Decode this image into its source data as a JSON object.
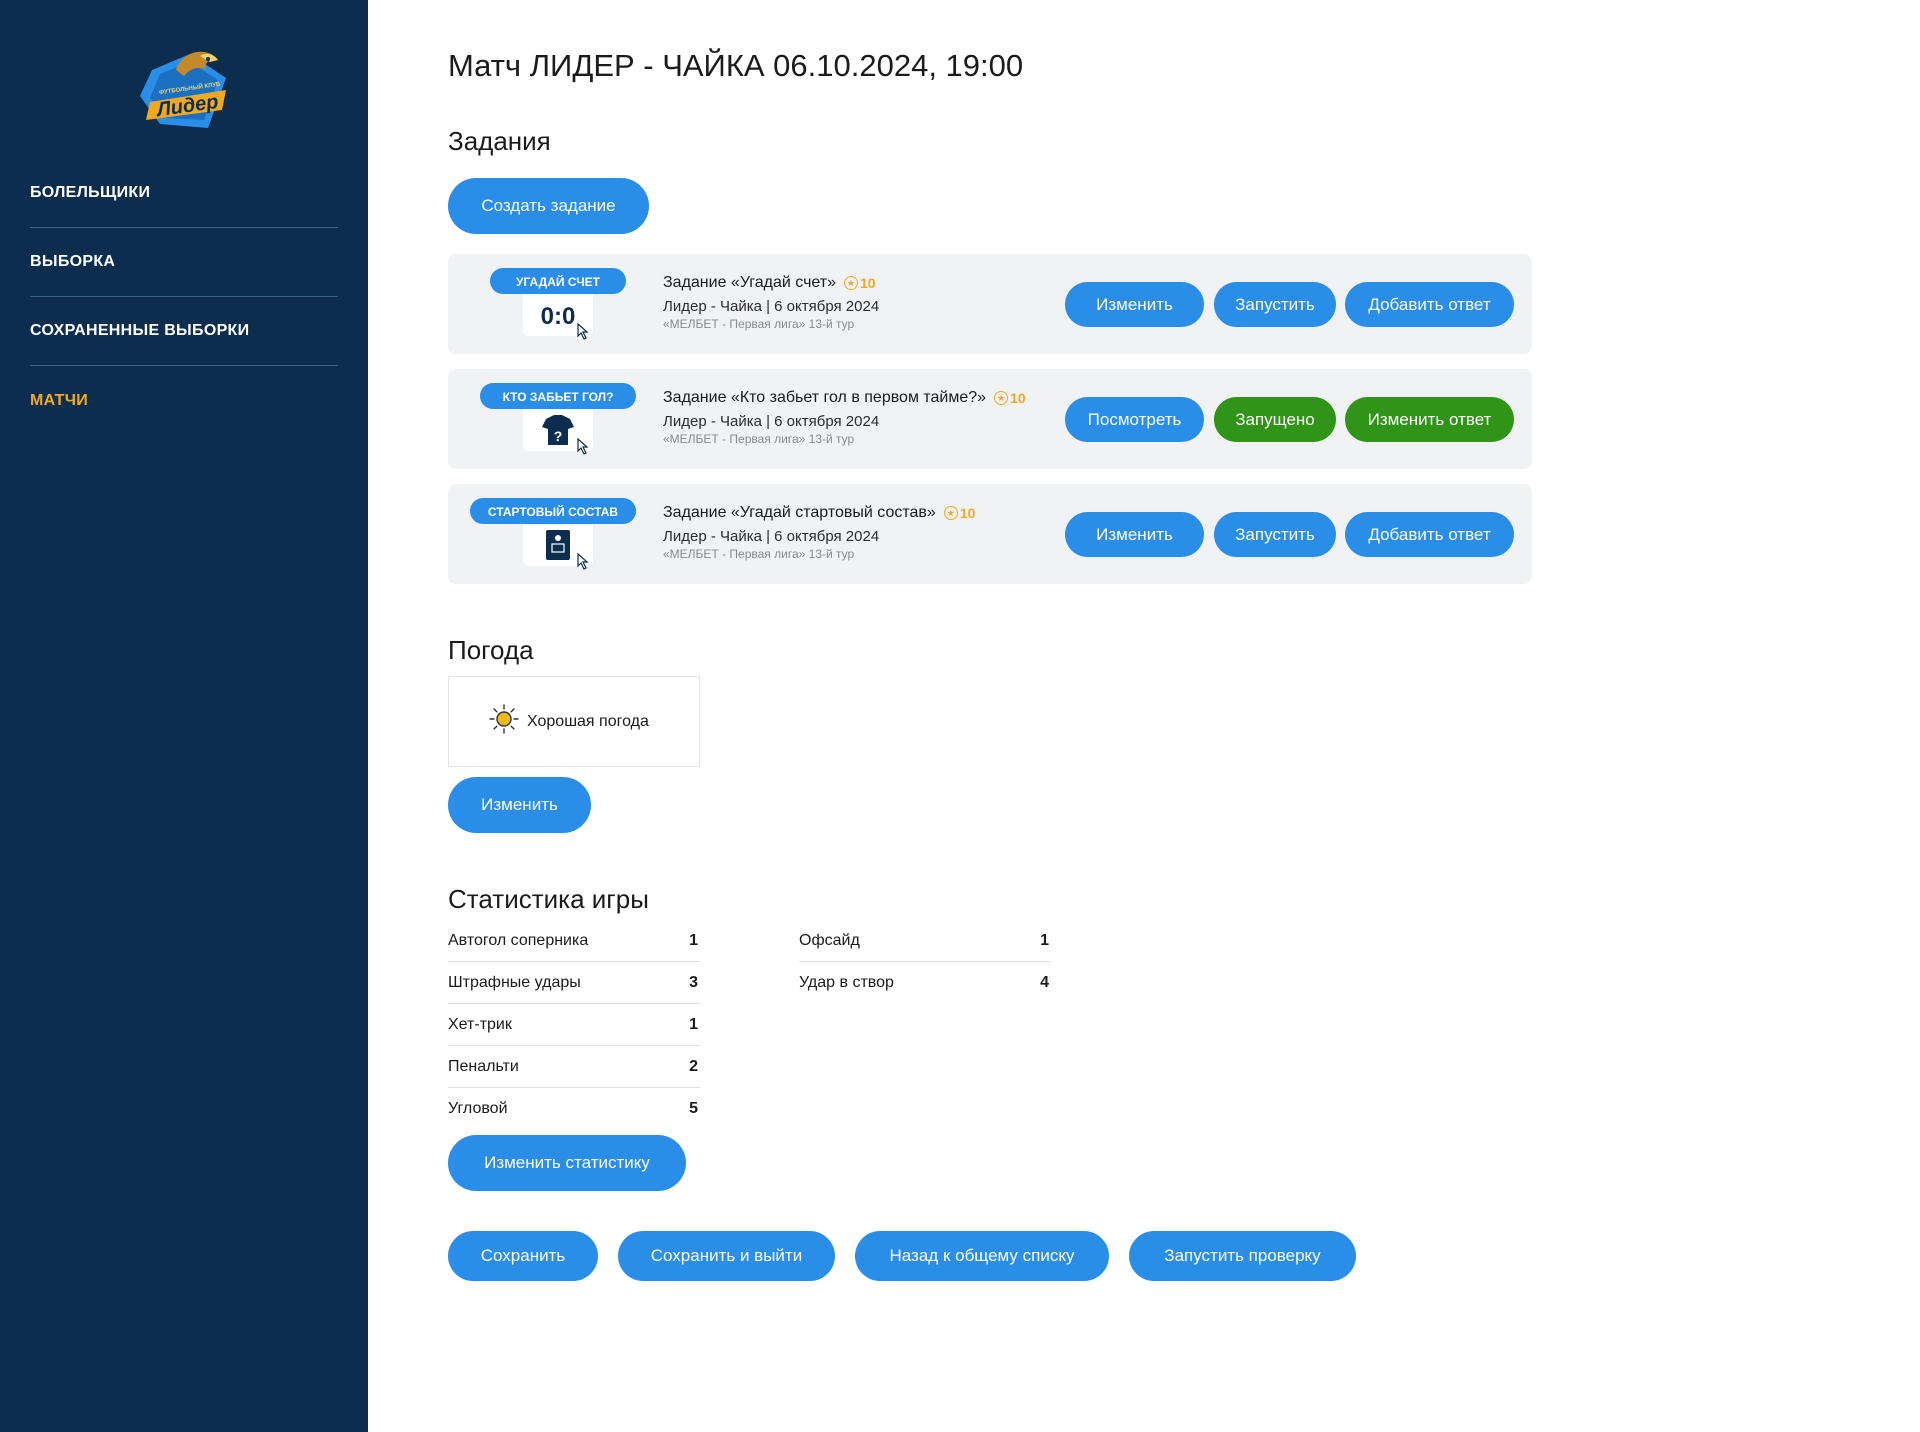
{
  "sidebar": {
    "logo_text": "Лидер",
    "logo_subtext": "ФУТБОЛЬНЫЙ КЛУБ",
    "items": [
      {
        "label": "БОЛЕЛЬЩИКИ",
        "active": false
      },
      {
        "label": "ВЫБОРКА",
        "active": false
      },
      {
        "label": "СОХРАНЕННЫЕ ВЫБОРКИ",
        "active": false
      },
      {
        "label": "МАТЧИ",
        "active": true
      }
    ]
  },
  "page": {
    "title": "Матч ЛИДЕР - ЧАЙКА 06.10.2024, 19:00"
  },
  "tasks": {
    "section_title": "Задания",
    "create_button": "Создать задание",
    "items": [
      {
        "badge": "УГАДАЙ СЧЕТ",
        "badge_extra": "0:0",
        "title": "Задание «Угадай счет»",
        "points": "10",
        "match": "Лидер - Чайка | 6 октября 2024",
        "league": "«МЕЛБЕТ - Первая лига» 13-й тур",
        "buttons": [
          {
            "label": "Изменить",
            "style": "blue"
          },
          {
            "label": "Запустить",
            "style": "blue"
          },
          {
            "label": "Добавить ответ",
            "style": "blue"
          }
        ]
      },
      {
        "badge": "КТО ЗАБЬЕТ ГОЛ?",
        "badge_extra": "?",
        "title": "Задание «Кто забьет гол в первом тайме?»",
        "points": "10",
        "match": "Лидер - Чайка | 6 октября 2024",
        "league": "«МЕЛБЕТ - Первая лига» 13-й тур",
        "buttons": [
          {
            "label": "Посмотреть",
            "style": "blue"
          },
          {
            "label": "Запущено",
            "style": "green"
          },
          {
            "label": "Изменить ответ",
            "style": "green"
          }
        ]
      },
      {
        "badge": "СТАРТОВЫЙ СОСТАВ",
        "badge_extra": "",
        "title": "Задание «Угадай стартовый состав»",
        "points": "10",
        "match": "Лидер - Чайка | 6 октября 2024",
        "league": "«МЕЛБЕТ - Первая лига» 13-й тур",
        "buttons": [
          {
            "label": "Изменить",
            "style": "blue"
          },
          {
            "label": "Запустить",
            "style": "blue"
          },
          {
            "label": "Добавить ответ",
            "style": "blue"
          }
        ]
      }
    ]
  },
  "weather": {
    "section_title": "Погода",
    "icon": "sun-icon",
    "label": "Хорошая погода",
    "edit_button": "Изменить"
  },
  "stats": {
    "section_title": "Статистика игры",
    "left": [
      {
        "label": "Автогол соперника",
        "value": "1"
      },
      {
        "label": "Штрафные удары",
        "value": "3"
      },
      {
        "label": "Хет-трик",
        "value": "1"
      },
      {
        "label": "Пенальти",
        "value": "2"
      },
      {
        "label": "Угловой",
        "value": "5"
      }
    ],
    "right": [
      {
        "label": "Офсайд",
        "value": "1"
      },
      {
        "label": "Удар в створ",
        "value": "4"
      }
    ],
    "edit_button": "Изменить статистику"
  },
  "actions": {
    "save": "Сохранить",
    "save_exit": "Сохранить и выйти",
    "back": "Назад к общему списку",
    "run_check": "Запустить проверку"
  },
  "colors": {
    "sidebar_bg": "#0c2d4d",
    "accent_blue": "#2a8de7",
    "accent_green": "#2f9418",
    "active_nav": "#f2a922",
    "card_bg": "#f1f2f4"
  }
}
